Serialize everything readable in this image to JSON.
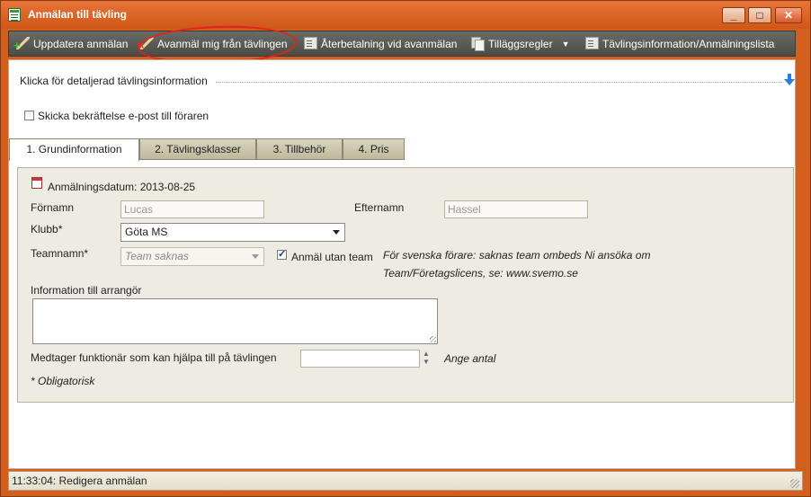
{
  "window": {
    "title": "Anmälan till tävling",
    "controls": {
      "minimize": "_",
      "maximize": "□",
      "close": "✕"
    }
  },
  "toolbar": {
    "items": [
      {
        "label": "Uppdatera anmälan",
        "icon": "pen-plus-icon"
      },
      {
        "label": "Avanmäl mig från tävlingen",
        "icon": "pen-remove-icon"
      },
      {
        "label": "Återbetalning vid avanmälan",
        "icon": "document-icon"
      },
      {
        "label": "Tilläggsregler",
        "icon": "documents-icon"
      },
      {
        "label": "Tävlingsinformation/Anmälningslista",
        "icon": "document-list-icon"
      }
    ]
  },
  "details_toggle": "Klicka för detaljerad tävlingsinformation",
  "confirm_email": {
    "label": "Skicka bekräftelse e-post till föraren",
    "checked": false
  },
  "tabs": [
    "1. Grundinformation",
    "2. Tävlingsklasser",
    "3. Tillbehör",
    "4. Pris"
  ],
  "form": {
    "date_label": "Anmälningsdatum: 2013-08-25",
    "firstname_label": "Förnamn",
    "firstname_value": "Lucas",
    "lastname_label": "Efternamn",
    "lastname_value": "Hassel",
    "club_label": "Klubb*",
    "club_value": "Göta MS",
    "team_label": "Teamnamn*",
    "team_value": "Team saknas",
    "no_team_label": "Anmäl utan team",
    "no_team_checked": true,
    "team_note_line1": "För svenska förare: saknas team ombeds Ni ansöka om",
    "team_note_line2": "Team/Företagslicens, se: www.svemo.se",
    "info_label": "Information till arrangör",
    "info_value": "",
    "officials_label": "Medtager funktionär som kan hjälpa till på tävlingen",
    "officials_value": "",
    "officials_hint": "Ange antal",
    "required_note": "* Obligatorisk"
  },
  "status": {
    "text": "11:33:04: Redigera anmälan"
  }
}
